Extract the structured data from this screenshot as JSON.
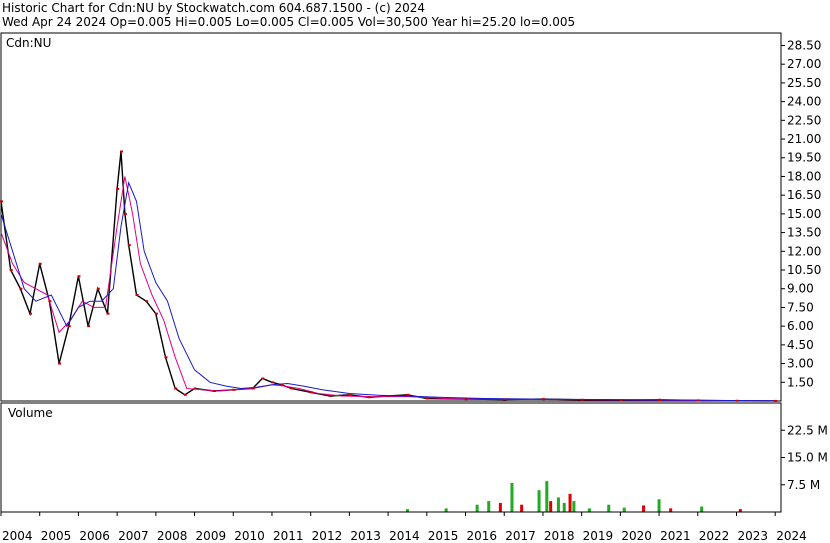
{
  "header": {
    "line1": "Historic Chart for Cdn:NU by Stockwatch.com 604.687.1500 - (c) 2024",
    "line2": "Wed Apr 24 2024   Op=0.005   Hi=0.005   Lo=0.005   Cl=0.005   Vol=30,500   Year hi=25.20   lo=0.005"
  },
  "chart_data": [
    {
      "type": "line",
      "panel_label": "Cdn:NU",
      "ylim": [
        0,
        29.5
      ],
      "y_ticks": [
        28.5,
        27.0,
        25.5,
        24.0,
        22.5,
        21.0,
        19.5,
        18.0,
        16.5,
        15.0,
        13.5,
        12.0,
        10.5,
        9.0,
        7.5,
        6.0,
        4.5,
        3.0,
        1.5
      ],
      "y_tick_labels": [
        "28.50",
        "27.00",
        "25.50",
        "24.00",
        "22.50",
        "21.00",
        "19.50",
        "18.00",
        "16.50",
        "15.00",
        "13.50",
        "12.00",
        "10.50",
        "9.00",
        "7.50",
        "6.00",
        "4.50",
        "3.00",
        "1.50"
      ],
      "colors": {
        "price": "#000000",
        "close_mark": "#cc0000",
        "ma_short": "#e0008a",
        "ma_long": "#1a1acc"
      },
      "series": [
        {
          "x": [
            2004.0,
            2004.25,
            2004.5,
            2004.75,
            2005.0,
            2005.25,
            2005.5,
            2005.75,
            2006.0,
            2006.25,
            2006.5,
            2006.75,
            2007.0,
            2007.1,
            2007.2,
            2007.3,
            2007.5,
            2007.75,
            2008.0,
            2008.25,
            2008.5,
            2008.75,
            2009.0,
            2009.5,
            2010.0,
            2010.5,
            2010.75,
            2011.0,
            2011.25,
            2011.5,
            2012.0,
            2012.5,
            2013.0,
            2013.5,
            2014.0,
            2014.5,
            2015.0,
            2016.0,
            2017.0,
            2018.0,
            2019.0,
            2020.0,
            2021.0,
            2022.0,
            2023.0,
            2024.0
          ],
          "values": [
            16.0,
            10.5,
            9.0,
            7.0,
            11.0,
            8.0,
            3.0,
            6.0,
            10.0,
            6.0,
            9.0,
            7.0,
            17.0,
            20.0,
            15.0,
            12.5,
            8.5,
            8.0,
            7.0,
            3.5,
            1.0,
            0.5,
            1.0,
            0.8,
            0.9,
            1.0,
            1.8,
            1.5,
            1.3,
            1.0,
            0.7,
            0.4,
            0.5,
            0.3,
            0.4,
            0.5,
            0.2,
            0.15,
            0.12,
            0.15,
            0.1,
            0.08,
            0.1,
            0.05,
            0.02,
            0.005
          ]
        },
        {
          "x": [
            2004.0,
            2004.3,
            2004.6,
            2004.9,
            2005.2,
            2005.5,
            2005.8,
            2006.1,
            2006.4,
            2006.7,
            2007.0,
            2007.2,
            2007.4,
            2007.6,
            2007.9,
            2008.2,
            2008.5,
            2008.8,
            2009.2,
            2009.6,
            2010.0,
            2010.5,
            2011.0,
            2011.3,
            2011.7,
            2012.2,
            2012.8,
            2013.5,
            2014.5,
            2015.5,
            2016.5,
            2018.0,
            2020.0,
            2022.0,
            2024.0
          ],
          "values": [
            13.5,
            11.0,
            9.5,
            9.0,
            8.5,
            5.5,
            6.5,
            8.0,
            7.5,
            7.5,
            14.0,
            18.0,
            15.0,
            11.0,
            8.5,
            6.5,
            3.5,
            1.0,
            0.9,
            0.8,
            0.9,
            1.0,
            1.3,
            1.2,
            1.0,
            0.6,
            0.4,
            0.35,
            0.35,
            0.2,
            0.15,
            0.12,
            0.08,
            0.04,
            0.01
          ]
        },
        {
          "x": [
            2004.0,
            2004.3,
            2004.6,
            2004.9,
            2005.3,
            2005.7,
            2006.0,
            2006.3,
            2006.6,
            2006.9,
            2007.1,
            2007.3,
            2007.5,
            2007.7,
            2008.0,
            2008.3,
            2008.6,
            2009.0,
            2009.4,
            2009.8,
            2010.2,
            2010.6,
            2011.0,
            2011.4,
            2011.8,
            2012.3,
            2013.0,
            2013.8,
            2014.5,
            2015.3,
            2016.5,
            2018.0,
            2020.0,
            2022.0,
            2024.0
          ],
          "values": [
            15.0,
            12.0,
            9.0,
            8.0,
            8.5,
            6.0,
            7.5,
            8.0,
            8.0,
            9.0,
            14.0,
            17.5,
            16.0,
            12.0,
            9.5,
            8.0,
            5.0,
            2.5,
            1.5,
            1.2,
            1.0,
            1.1,
            1.3,
            1.4,
            1.2,
            0.9,
            0.6,
            0.45,
            0.4,
            0.3,
            0.2,
            0.15,
            0.1,
            0.06,
            0.02
          ]
        }
      ]
    },
    {
      "type": "bar",
      "panel_label": "Volume",
      "ylim": [
        0,
        30
      ],
      "y_ticks": [
        22.5,
        15.0,
        7.5
      ],
      "y_tick_labels": [
        "22.5 M",
        "15.0 M",
        "7.5 M"
      ],
      "colors": {
        "up": "#22aa22",
        "down": "#dd0000"
      },
      "x_ticks": [
        "2004",
        "2005",
        "2006",
        "2007",
        "2008",
        "2009",
        "2010",
        "2011",
        "2012",
        "2013",
        "2014",
        "2015",
        "2016",
        "2017",
        "2018",
        "2019",
        "2020",
        "2021",
        "2022",
        "2023",
        "2024"
      ],
      "bars": [
        {
          "x": 2014.5,
          "value": 0.8,
          "dir": "up"
        },
        {
          "x": 2015.5,
          "value": 1.0,
          "dir": "up"
        },
        {
          "x": 2016.3,
          "value": 2.0,
          "dir": "up"
        },
        {
          "x": 2016.6,
          "value": 3.0,
          "dir": "up"
        },
        {
          "x": 2016.9,
          "value": 2.5,
          "dir": "down"
        },
        {
          "x": 2017.2,
          "value": 8.0,
          "dir": "up"
        },
        {
          "x": 2017.45,
          "value": 2.0,
          "dir": "down"
        },
        {
          "x": 2017.9,
          "value": 6.0,
          "dir": "up"
        },
        {
          "x": 2018.1,
          "value": 8.5,
          "dir": "up"
        },
        {
          "x": 2018.2,
          "value": 3.0,
          "dir": "down"
        },
        {
          "x": 2018.4,
          "value": 4.0,
          "dir": "up"
        },
        {
          "x": 2018.55,
          "value": 2.5,
          "dir": "up"
        },
        {
          "x": 2018.7,
          "value": 5.0,
          "dir": "down"
        },
        {
          "x": 2018.8,
          "value": 3.0,
          "dir": "up"
        },
        {
          "x": 2019.2,
          "value": 1.0,
          "dir": "up"
        },
        {
          "x": 2019.7,
          "value": 2.0,
          "dir": "up"
        },
        {
          "x": 2020.1,
          "value": 1.2,
          "dir": "up"
        },
        {
          "x": 2020.6,
          "value": 1.8,
          "dir": "down"
        },
        {
          "x": 2021.0,
          "value": 3.5,
          "dir": "up"
        },
        {
          "x": 2021.3,
          "value": 1.0,
          "dir": "down"
        },
        {
          "x": 2022.1,
          "value": 1.5,
          "dir": "up"
        },
        {
          "x": 2023.1,
          "value": 0.8,
          "dir": "down"
        }
      ]
    }
  ]
}
